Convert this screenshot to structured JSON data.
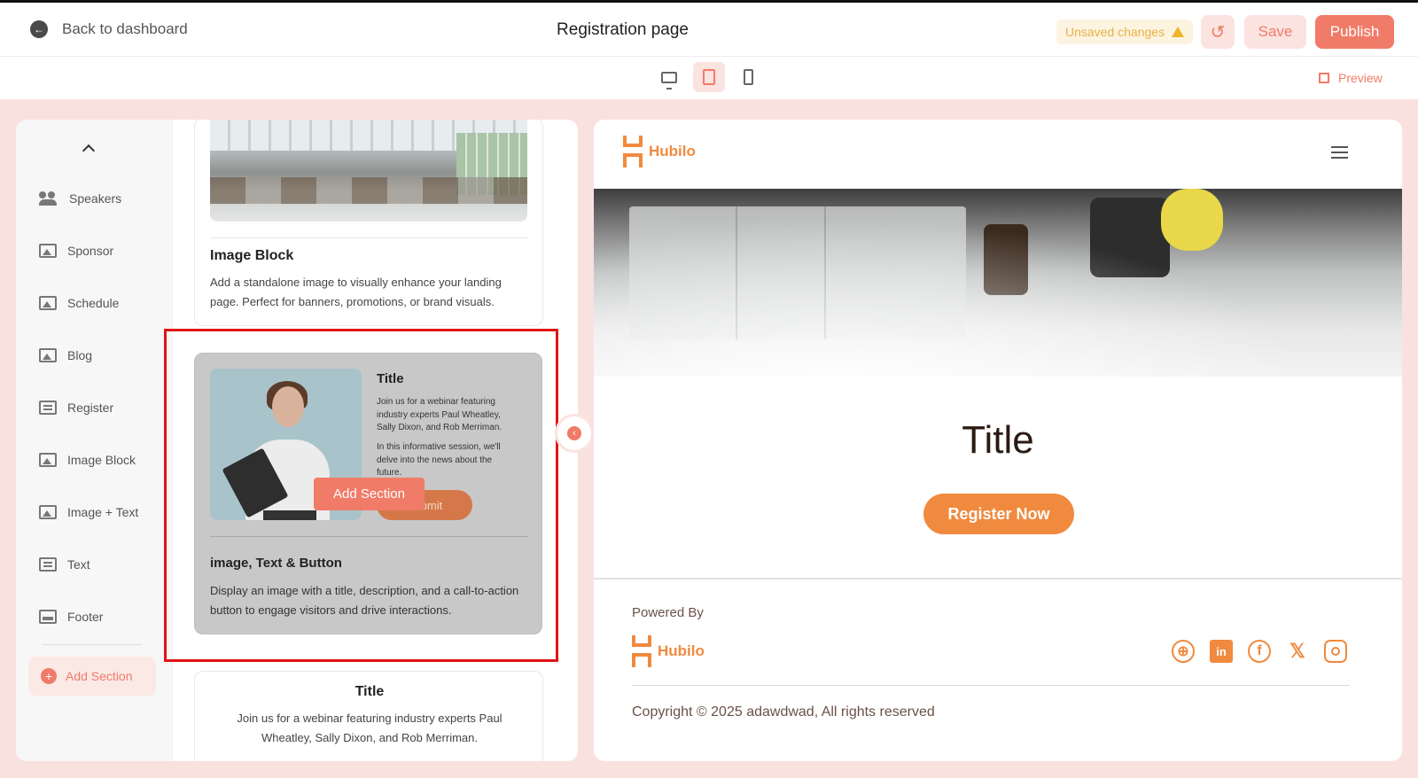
{
  "header": {
    "back_label": "Back to dashboard",
    "page_title": "Registration page",
    "unsaved_label": "Unsaved changes",
    "save_label": "Save",
    "publish_label": "Publish"
  },
  "devices": {
    "active": "tablet",
    "preview_label": "Preview"
  },
  "sidebar": {
    "items": [
      {
        "label": "Speakers",
        "icon": "speakers-icon"
      },
      {
        "label": "Sponsor",
        "icon": "image-icon"
      },
      {
        "label": "Schedule",
        "icon": "image-icon"
      },
      {
        "label": "Blog",
        "icon": "image-icon"
      },
      {
        "label": "Register",
        "icon": "text-icon"
      },
      {
        "label": "Image Block",
        "icon": "image-icon"
      },
      {
        "label": "Image + Text",
        "icon": "image-icon"
      },
      {
        "label": "Text",
        "icon": "text-icon"
      },
      {
        "label": "Footer",
        "icon": "footer-icon"
      }
    ],
    "add_section_label": "Add Section"
  },
  "cards": {
    "image_block": {
      "title": "Image Block",
      "description": "Add a standalone image to visually enhance your landing page. Perfect for banners, promotions, or brand visuals."
    },
    "image_text_button": {
      "preview_title": "Title",
      "preview_desc_1": "Join us for a webinar featuring industry experts Paul Wheatley, Sally Dixon, and Rob Merriman.",
      "preview_desc_2": "In this informative session, we'll delve into the news about the future.",
      "preview_button": "Submit",
      "hover_add_label": "Add Section",
      "title": "image, Text & Button",
      "description": "Display an image with a title, description, and a call-to-action button to engage visitors and drive interactions."
    },
    "text_card": {
      "title": "Title",
      "description": "Join us for a webinar featuring industry experts Paul Wheatley, Sally Dixon, and Rob Merriman."
    }
  },
  "preview": {
    "brand": "Hubilo",
    "title": "Title",
    "cta_label": "Register Now",
    "powered_by": "Powered By",
    "footer_brand": "Hubilo",
    "copyright": "Copyright © 2025 adawdwad, All rights reserved",
    "socials": [
      "globe-icon",
      "linkedin-icon",
      "facebook-icon",
      "x-icon",
      "instagram-icon"
    ]
  },
  "colors": {
    "accent": "#f07b68",
    "brand_orange": "#f08a3f",
    "page_bg": "#f9e1de",
    "selection": "#e01414"
  }
}
